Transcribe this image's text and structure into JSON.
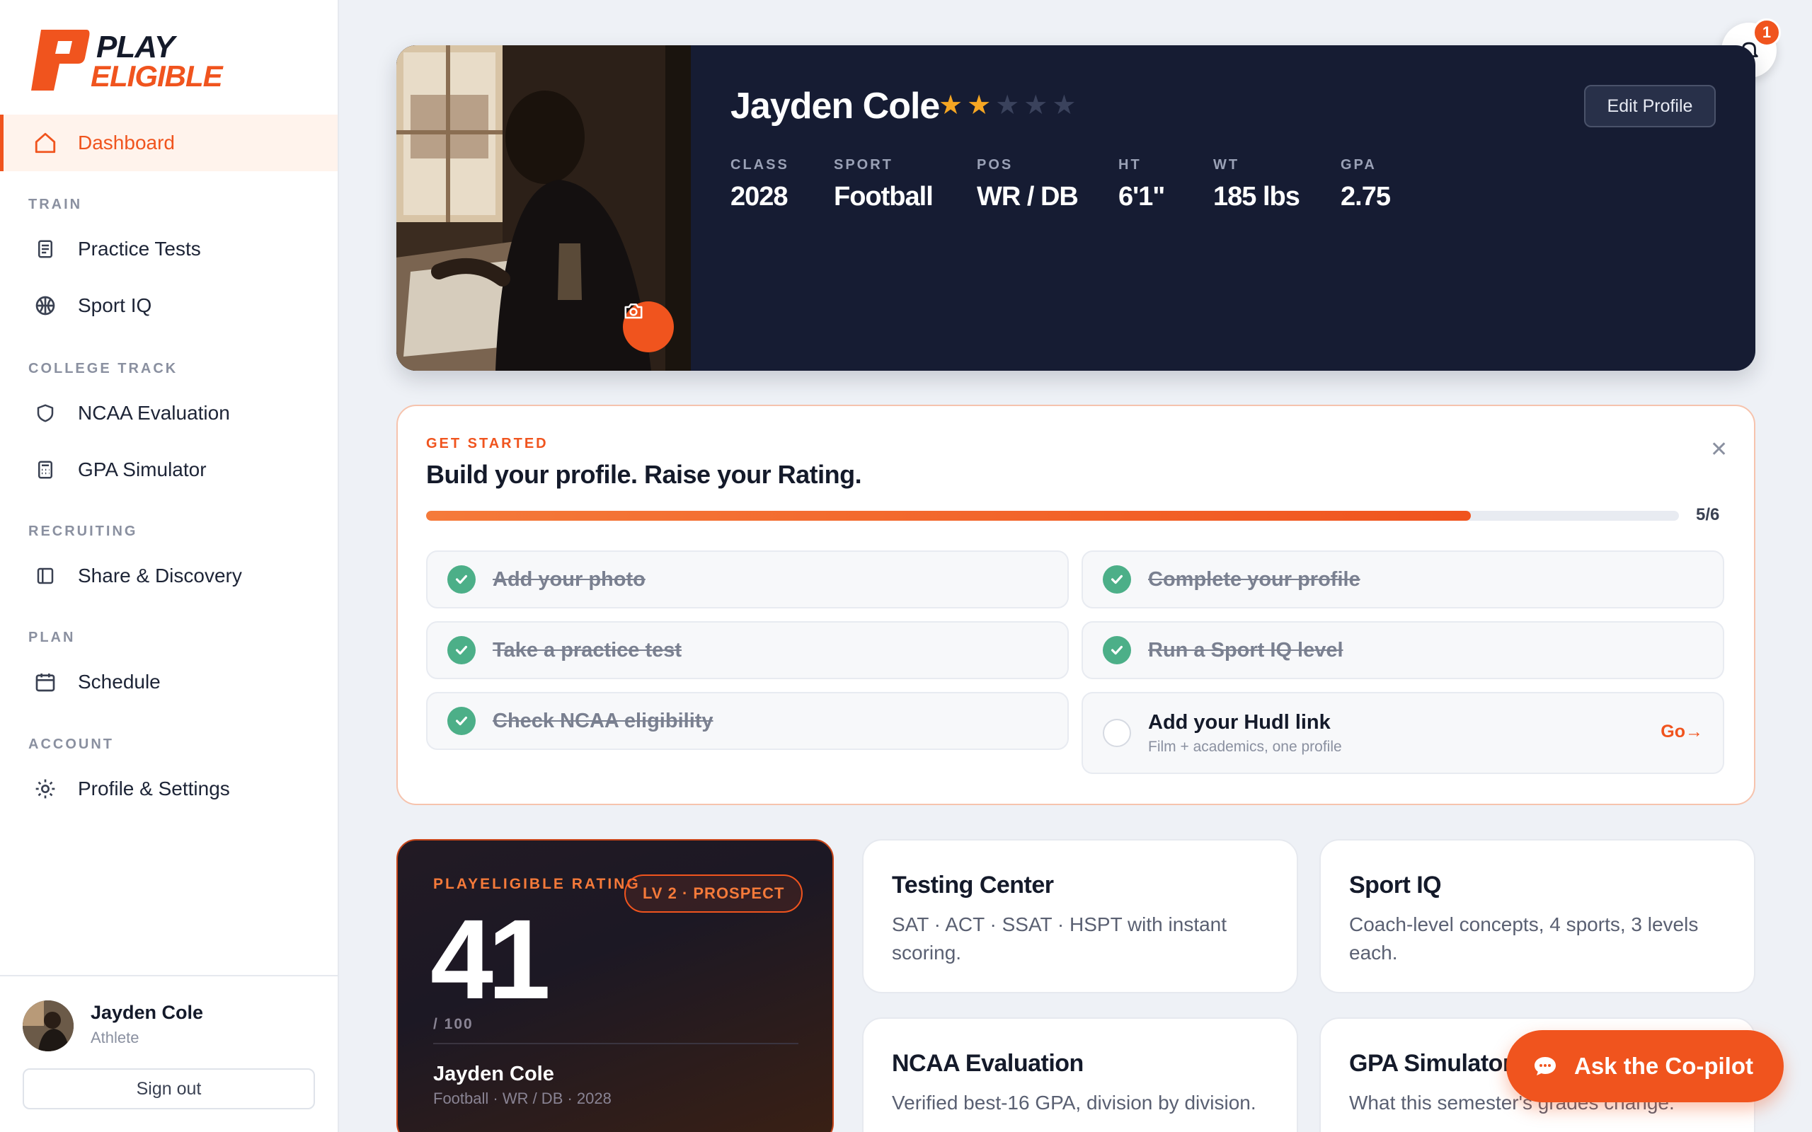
{
  "brand": {
    "line1": "PLAY",
    "line2": "ELIGIBLE",
    "accent": "#f0541e"
  },
  "nav": {
    "dashboard": "Dashboard",
    "sections": {
      "train": "TRAIN",
      "college_track": "COLLEGE TRACK",
      "recruiting": "RECRUITING",
      "plan": "PLAN",
      "account": "ACCOUNT"
    },
    "items": {
      "practice_tests": "Practice Tests",
      "sport_iq": "Sport IQ",
      "ncaa_evaluation": "NCAA Evaluation",
      "gpa_simulator": "GPA Simulator",
      "share_discovery": "Share & Discovery",
      "schedule": "Schedule",
      "profile_settings": "Profile & Settings"
    }
  },
  "user": {
    "name": "Jayden Cole",
    "role": "Athlete",
    "sign_out": "Sign out"
  },
  "notifications": {
    "count": "1"
  },
  "hero": {
    "name": "Jayden Cole",
    "stars_filled": 2,
    "stars_total": 5,
    "edit_label": "Edit Profile",
    "stats": {
      "class": {
        "label": "CLASS",
        "value": "2028"
      },
      "sport": {
        "label": "SPORT",
        "value": "Football"
      },
      "pos": {
        "label": "POS",
        "value": "WR / DB"
      },
      "ht": {
        "label": "HT",
        "value": "6'1\""
      },
      "wt": {
        "label": "WT",
        "value": "185 lbs"
      },
      "gpa": {
        "label": "GPA",
        "value": "2.75"
      }
    }
  },
  "get_started": {
    "eyebrow": "GET STARTED",
    "title": "Build your profile. Raise your Rating.",
    "progress": 0.834,
    "count": "5/6",
    "tasks": {
      "photo": "Add your photo",
      "complete_profile": "Complete your profile",
      "practice_test": "Take a practice test",
      "sport_iq": "Run a Sport IQ level",
      "ncaa": "Check NCAA eligibility",
      "hudl": "Add your Hudl link",
      "hudl_sub": "Film + academics, one profile",
      "go": "Go→"
    }
  },
  "rating": {
    "eyebrow": "PLAYELIGIBLE RATING",
    "badge": "LV 2 · PROSPECT",
    "value": "41",
    "scale": "/ 100",
    "name": "Jayden Cole",
    "meta": "Football · WR / DB · 2028"
  },
  "cards": {
    "testing": {
      "title": "Testing Center",
      "desc": "SAT · ACT · SSAT · HSPT with instant scoring."
    },
    "sport_iq": {
      "title": "Sport IQ",
      "desc": "Coach-level concepts, 4 sports, 3 levels each."
    },
    "ncaa": {
      "title": "NCAA Evaluation",
      "desc": "Verified best-16 GPA, division by division."
    },
    "gpa": {
      "title": "GPA Simulator",
      "desc": "What this semester's grades change."
    }
  },
  "copilot": {
    "label": "Ask the Co-pilot"
  }
}
